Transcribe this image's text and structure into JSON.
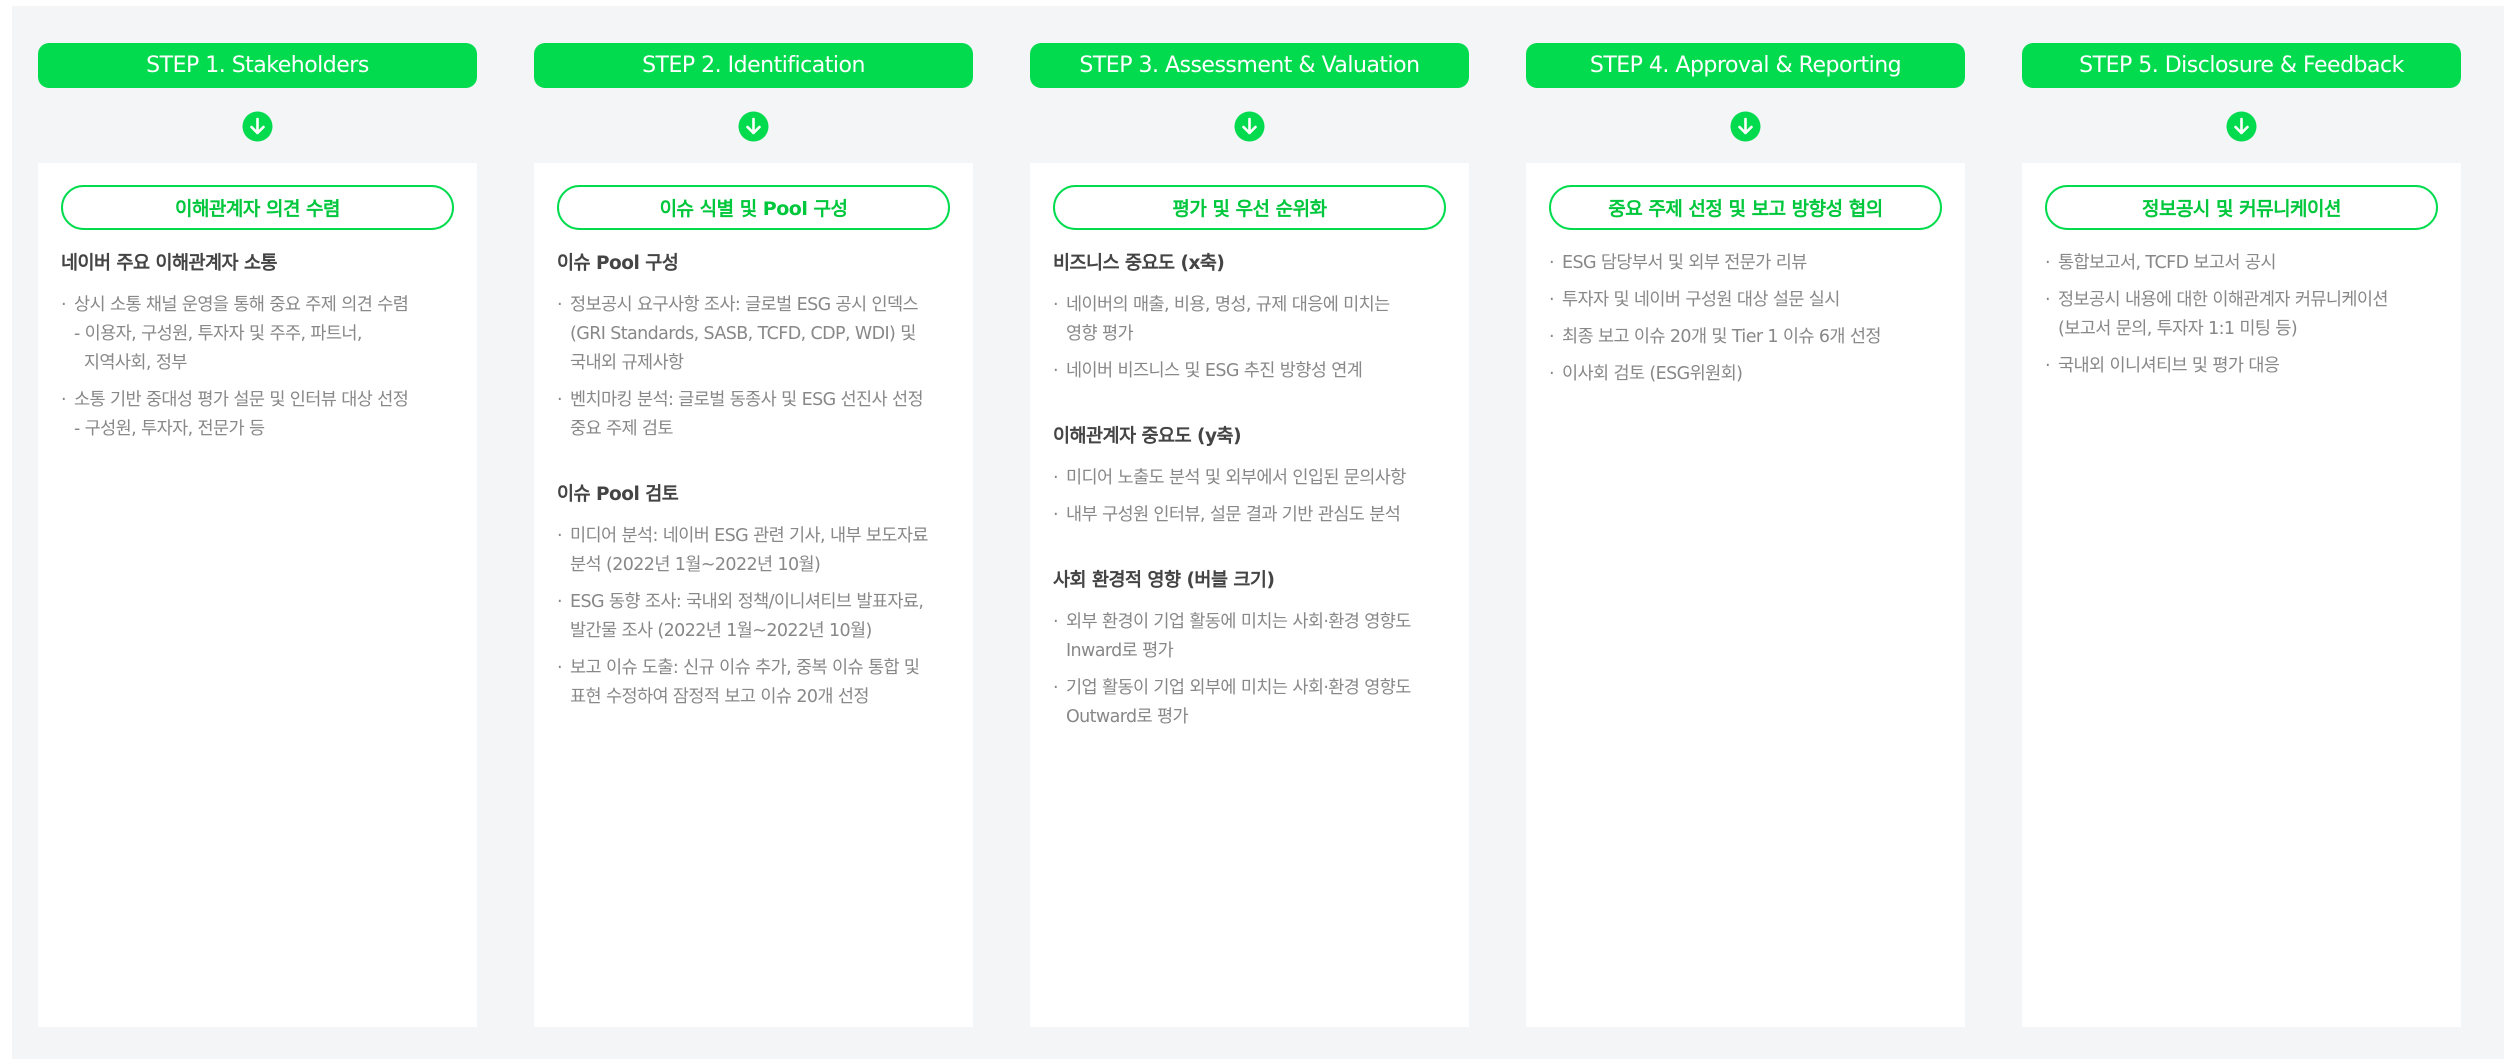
{
  "steps": [
    {
      "label": "STEP 1. Stakeholders",
      "box_title": "이해관계자 의견 수렴",
      "sections": [
        {
          "title": "네이버 주요 이해관계자 소통",
          "bullets": [
            {
              "lines": [
                "상시 소통 채널 운영을 통해 중요 주제 의견 수렴"
              ],
              "sub": [
                "- 이용자, 구성원, 투자자 및 주주, 파트너,",
                "  지역사회, 정부"
              ]
            },
            {
              "lines": [
                "소통 기반 중대성 평가 설문 및 인터뷰 대상 선정"
              ],
              "sub": [
                "- 구성원, 투자자, 전문가 등"
              ]
            }
          ]
        }
      ]
    },
    {
      "label": "STEP 2. Identification",
      "box_title": "이슈 식별 및 Pool 구성",
      "sections": [
        {
          "title": "이슈 Pool 구성",
          "bullets": [
            {
              "lines": [
                "정보공시 요구사항 조사: 글로벌 ESG 공시 인덱스",
                "(GRI Standards, SASB, TCFD, CDP, WDI) 및",
                "국내외 규제사항"
              ]
            },
            {
              "lines": [
                "벤치마킹 분석: 글로벌 동종사 및 ESG 선진사 선정",
                "중요 주제 검토"
              ]
            }
          ]
        },
        {
          "title": "이슈 Pool 검토",
          "bullets": [
            {
              "lines": [
                "미디어 분석: 네이버 ESG 관련 기사, 내부 보도자료",
                "분석 (2022년 1월~2022년 10월)"
              ]
            },
            {
              "lines": [
                "ESG 동향 조사: 국내외 정책/이니셔티브 발표자료,",
                "발간물 조사 (2022년 1월~2022년 10월)"
              ]
            },
            {
              "lines": [
                "보고 이슈 도출: 신규 이슈 추가, 중복 이슈 통합 및",
                "표현 수정하여 잠정적 보고 이슈 20개 선정"
              ]
            }
          ]
        }
      ]
    },
    {
      "label": "STEP 3. Assessment & Valuation",
      "box_title": "평가 및 우선 순위화",
      "sections": [
        {
          "title": "비즈니스 중요도 (x축)",
          "bullets": [
            {
              "lines": [
                "네이버의 매출, 비용, 명성, 규제 대응에 미치는",
                "영향 평가"
              ]
            },
            {
              "lines": [
                "네이버 비즈니스 및 ESG 추진 방향성 연계"
              ]
            }
          ]
        },
        {
          "title": "이해관계자 중요도 (y축)",
          "bullets": [
            {
              "lines": [
                "미디어 노출도 분석 및 외부에서 인입된 문의사항"
              ]
            },
            {
              "lines": [
                "내부 구성원 인터뷰, 설문 결과 기반 관심도 분석"
              ]
            }
          ]
        },
        {
          "title": "사회 환경적 영향 (버블 크기)",
          "bullets": [
            {
              "lines": [
                "외부 환경이 기업 활동에 미치는 사회·환경 영향도",
                "Inward로 평가"
              ]
            },
            {
              "lines": [
                "기업 활동이 기업 외부에 미치는 사회·환경 영향도",
                "Outward로 평가"
              ]
            }
          ]
        }
      ]
    },
    {
      "label": "STEP 4. Approval & Reporting",
      "box_title": "중요 주제 선정 및 보고 방향성 협의",
      "sections": [
        {
          "title": "",
          "bullets": [
            {
              "lines": [
                "ESG 담당부서 및 외부 전문가 리뷰"
              ]
            },
            {
              "lines": [
                "투자자 및 네이버 구성원 대상 설문 실시"
              ]
            },
            {
              "lines": [
                "최종 보고 이슈 20개 및 Tier 1 이슈 6개 선정"
              ]
            },
            {
              "lines": [
                "이사회 검토 (ESG위원회)"
              ]
            }
          ]
        }
      ]
    },
    {
      "label": "STEP 5. Disclosure & Feedback",
      "box_title": "정보공시 및 커뮤니케이션",
      "sections": [
        {
          "title": "",
          "bullets": [
            {
              "lines": [
                "통합보고서, TCFD 보고서 공시"
              ]
            },
            {
              "lines": [
                "정보공시 내용에 대한 이해관계자 커뮤니케이션",
                "(보고서 문의, 투자자 1:1 미팅 등)"
              ]
            },
            {
              "lines": [
                "국내외 이니셔티브 및 평가 대응"
              ]
            }
          ]
        }
      ]
    }
  ],
  "colors": {
    "accent": "#03db4f",
    "accent_text": "#00c73c",
    "panel_bg": "#f4f5f7"
  },
  "icons": {
    "step_arrow": "arrow-down-circle-icon"
  }
}
